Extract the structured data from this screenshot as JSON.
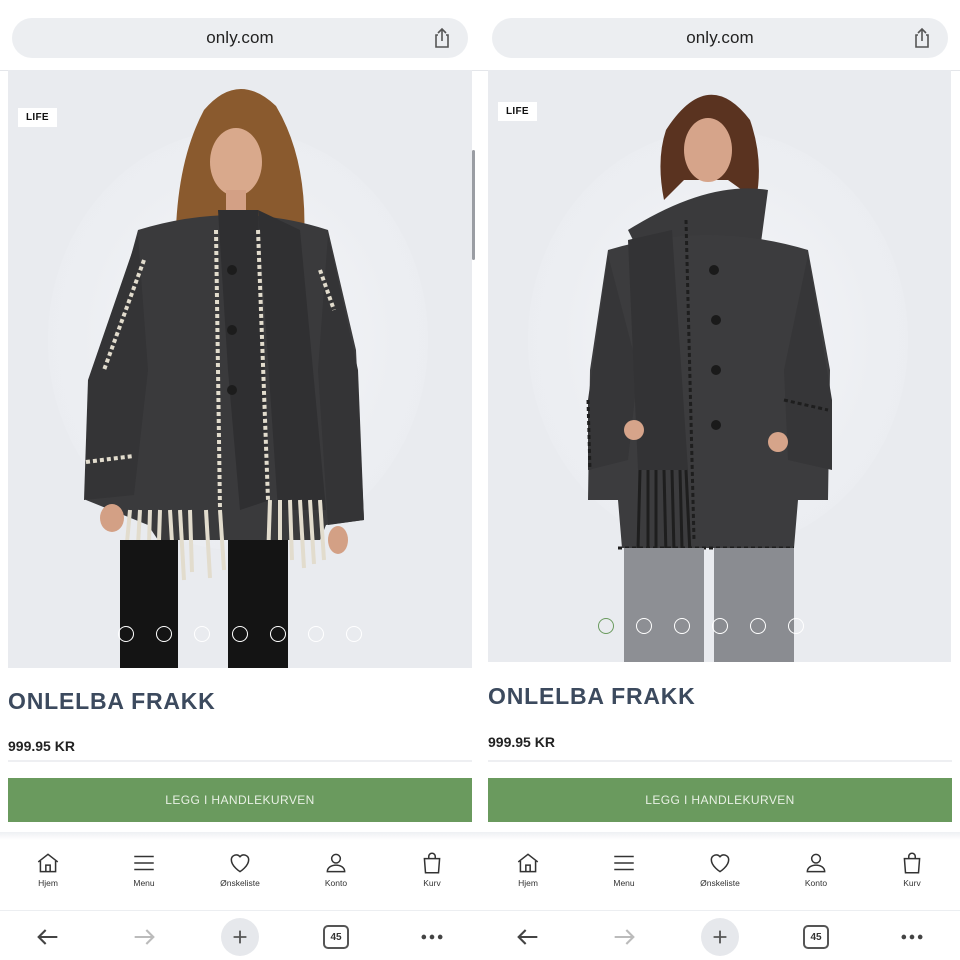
{
  "browser": {
    "url": "only.com"
  },
  "panels": [
    {
      "badge": "LIFE",
      "product_title": "ONLELBA FRAKK",
      "price": "999.95 KR",
      "cta_label": "LEGG I HANDLEKURVEN",
      "dots": {
        "count": 7,
        "active_index": -1
      },
      "coat_color": "#3a3a3c",
      "trim_color": "#e2dccd"
    },
    {
      "badge": "LIFE",
      "product_title": "ONLELBA FRAKK",
      "price": "999.95 KR",
      "cta_label": "LEGG I HANDLEKURVEN",
      "dots": {
        "count": 6,
        "active_index": 0
      },
      "coat_color": "#3c3c3e",
      "trim_color": "#1e1e1e"
    }
  ],
  "app_nav": [
    {
      "label": "Hjem",
      "icon": "home-icon"
    },
    {
      "label": "Menu",
      "icon": "menu-icon"
    },
    {
      "label": "Ønskeliste",
      "icon": "heart-icon"
    },
    {
      "label": "Konto",
      "icon": "account-icon"
    },
    {
      "label": "Kurv",
      "icon": "bag-icon"
    }
  ],
  "toolbar": {
    "tab_count": "45"
  },
  "colors": {
    "accent": "#6a9a5e",
    "title": "#3c4a5e",
    "image_bg": "#e9ebef"
  }
}
